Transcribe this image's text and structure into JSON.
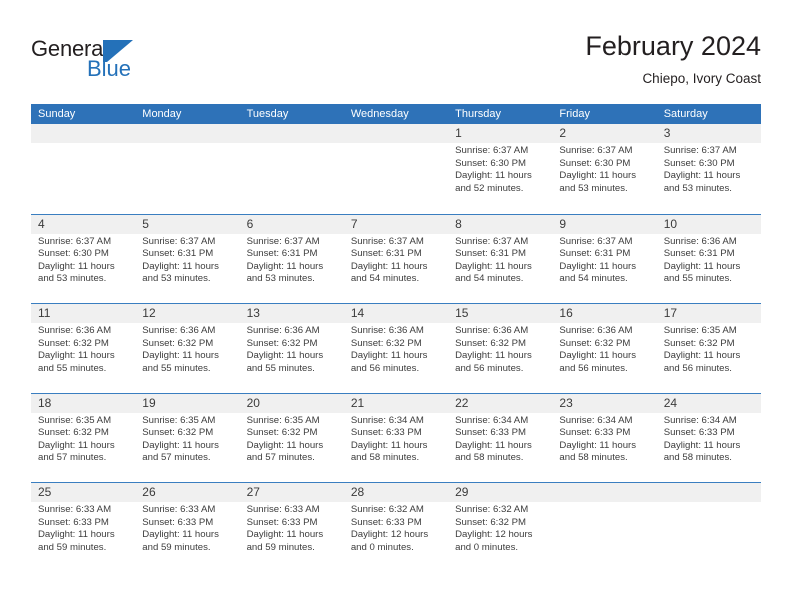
{
  "brand": {
    "name_part1": "General",
    "name_part2": "Blue",
    "logo_icon": "triangle-flag-icon",
    "color_primary": "#2471b9",
    "color_text": "#231f20"
  },
  "header": {
    "title": "February 2024",
    "subtitle": "Chiepo, Ivory Coast"
  },
  "theme": {
    "header_band": "#2e72b8",
    "daynum_strip": "#f0f0f0",
    "row_divider": "#3a7ec0"
  },
  "weekdays": [
    "Sunday",
    "Monday",
    "Tuesday",
    "Wednesday",
    "Thursday",
    "Friday",
    "Saturday"
  ],
  "weeks": [
    [
      {
        "day": "",
        "sunrise": "",
        "sunset": "",
        "daylight_line1": "",
        "daylight_line2": ""
      },
      {
        "day": "",
        "sunrise": "",
        "sunset": "",
        "daylight_line1": "",
        "daylight_line2": ""
      },
      {
        "day": "",
        "sunrise": "",
        "sunset": "",
        "daylight_line1": "",
        "daylight_line2": ""
      },
      {
        "day": "",
        "sunrise": "",
        "sunset": "",
        "daylight_line1": "",
        "daylight_line2": ""
      },
      {
        "day": "1",
        "sunrise": "Sunrise: 6:37 AM",
        "sunset": "Sunset: 6:30 PM",
        "daylight_line1": "Daylight: 11 hours",
        "daylight_line2": "and 52 minutes."
      },
      {
        "day": "2",
        "sunrise": "Sunrise: 6:37 AM",
        "sunset": "Sunset: 6:30 PM",
        "daylight_line1": "Daylight: 11 hours",
        "daylight_line2": "and 53 minutes."
      },
      {
        "day": "3",
        "sunrise": "Sunrise: 6:37 AM",
        "sunset": "Sunset: 6:30 PM",
        "daylight_line1": "Daylight: 11 hours",
        "daylight_line2": "and 53 minutes."
      }
    ],
    [
      {
        "day": "4",
        "sunrise": "Sunrise: 6:37 AM",
        "sunset": "Sunset: 6:30 PM",
        "daylight_line1": "Daylight: 11 hours",
        "daylight_line2": "and 53 minutes."
      },
      {
        "day": "5",
        "sunrise": "Sunrise: 6:37 AM",
        "sunset": "Sunset: 6:31 PM",
        "daylight_line1": "Daylight: 11 hours",
        "daylight_line2": "and 53 minutes."
      },
      {
        "day": "6",
        "sunrise": "Sunrise: 6:37 AM",
        "sunset": "Sunset: 6:31 PM",
        "daylight_line1": "Daylight: 11 hours",
        "daylight_line2": "and 53 minutes."
      },
      {
        "day": "7",
        "sunrise": "Sunrise: 6:37 AM",
        "sunset": "Sunset: 6:31 PM",
        "daylight_line1": "Daylight: 11 hours",
        "daylight_line2": "and 54 minutes."
      },
      {
        "day": "8",
        "sunrise": "Sunrise: 6:37 AM",
        "sunset": "Sunset: 6:31 PM",
        "daylight_line1": "Daylight: 11 hours",
        "daylight_line2": "and 54 minutes."
      },
      {
        "day": "9",
        "sunrise": "Sunrise: 6:37 AM",
        "sunset": "Sunset: 6:31 PM",
        "daylight_line1": "Daylight: 11 hours",
        "daylight_line2": "and 54 minutes."
      },
      {
        "day": "10",
        "sunrise": "Sunrise: 6:36 AM",
        "sunset": "Sunset: 6:31 PM",
        "daylight_line1": "Daylight: 11 hours",
        "daylight_line2": "and 55 minutes."
      }
    ],
    [
      {
        "day": "11",
        "sunrise": "Sunrise: 6:36 AM",
        "sunset": "Sunset: 6:32 PM",
        "daylight_line1": "Daylight: 11 hours",
        "daylight_line2": "and 55 minutes."
      },
      {
        "day": "12",
        "sunrise": "Sunrise: 6:36 AM",
        "sunset": "Sunset: 6:32 PM",
        "daylight_line1": "Daylight: 11 hours",
        "daylight_line2": "and 55 minutes."
      },
      {
        "day": "13",
        "sunrise": "Sunrise: 6:36 AM",
        "sunset": "Sunset: 6:32 PM",
        "daylight_line1": "Daylight: 11 hours",
        "daylight_line2": "and 55 minutes."
      },
      {
        "day": "14",
        "sunrise": "Sunrise: 6:36 AM",
        "sunset": "Sunset: 6:32 PM",
        "daylight_line1": "Daylight: 11 hours",
        "daylight_line2": "and 56 minutes."
      },
      {
        "day": "15",
        "sunrise": "Sunrise: 6:36 AM",
        "sunset": "Sunset: 6:32 PM",
        "daylight_line1": "Daylight: 11 hours",
        "daylight_line2": "and 56 minutes."
      },
      {
        "day": "16",
        "sunrise": "Sunrise: 6:36 AM",
        "sunset": "Sunset: 6:32 PM",
        "daylight_line1": "Daylight: 11 hours",
        "daylight_line2": "and 56 minutes."
      },
      {
        "day": "17",
        "sunrise": "Sunrise: 6:35 AM",
        "sunset": "Sunset: 6:32 PM",
        "daylight_line1": "Daylight: 11 hours",
        "daylight_line2": "and 56 minutes."
      }
    ],
    [
      {
        "day": "18",
        "sunrise": "Sunrise: 6:35 AM",
        "sunset": "Sunset: 6:32 PM",
        "daylight_line1": "Daylight: 11 hours",
        "daylight_line2": "and 57 minutes."
      },
      {
        "day": "19",
        "sunrise": "Sunrise: 6:35 AM",
        "sunset": "Sunset: 6:32 PM",
        "daylight_line1": "Daylight: 11 hours",
        "daylight_line2": "and 57 minutes."
      },
      {
        "day": "20",
        "sunrise": "Sunrise: 6:35 AM",
        "sunset": "Sunset: 6:32 PM",
        "daylight_line1": "Daylight: 11 hours",
        "daylight_line2": "and 57 minutes."
      },
      {
        "day": "21",
        "sunrise": "Sunrise: 6:34 AM",
        "sunset": "Sunset: 6:33 PM",
        "daylight_line1": "Daylight: 11 hours",
        "daylight_line2": "and 58 minutes."
      },
      {
        "day": "22",
        "sunrise": "Sunrise: 6:34 AM",
        "sunset": "Sunset: 6:33 PM",
        "daylight_line1": "Daylight: 11 hours",
        "daylight_line2": "and 58 minutes."
      },
      {
        "day": "23",
        "sunrise": "Sunrise: 6:34 AM",
        "sunset": "Sunset: 6:33 PM",
        "daylight_line1": "Daylight: 11 hours",
        "daylight_line2": "and 58 minutes."
      },
      {
        "day": "24",
        "sunrise": "Sunrise: 6:34 AM",
        "sunset": "Sunset: 6:33 PM",
        "daylight_line1": "Daylight: 11 hours",
        "daylight_line2": "and 58 minutes."
      }
    ],
    [
      {
        "day": "25",
        "sunrise": "Sunrise: 6:33 AM",
        "sunset": "Sunset: 6:33 PM",
        "daylight_line1": "Daylight: 11 hours",
        "daylight_line2": "and 59 minutes."
      },
      {
        "day": "26",
        "sunrise": "Sunrise: 6:33 AM",
        "sunset": "Sunset: 6:33 PM",
        "daylight_line1": "Daylight: 11 hours",
        "daylight_line2": "and 59 minutes."
      },
      {
        "day": "27",
        "sunrise": "Sunrise: 6:33 AM",
        "sunset": "Sunset: 6:33 PM",
        "daylight_line1": "Daylight: 11 hours",
        "daylight_line2": "and 59 minutes."
      },
      {
        "day": "28",
        "sunrise": "Sunrise: 6:32 AM",
        "sunset": "Sunset: 6:33 PM",
        "daylight_line1": "Daylight: 12 hours",
        "daylight_line2": "and 0 minutes."
      },
      {
        "day": "29",
        "sunrise": "Sunrise: 6:32 AM",
        "sunset": "Sunset: 6:32 PM",
        "daylight_line1": "Daylight: 12 hours",
        "daylight_line2": "and 0 minutes."
      },
      {
        "day": "",
        "sunrise": "",
        "sunset": "",
        "daylight_line1": "",
        "daylight_line2": ""
      },
      {
        "day": "",
        "sunrise": "",
        "sunset": "",
        "daylight_line1": "",
        "daylight_line2": ""
      }
    ]
  ]
}
